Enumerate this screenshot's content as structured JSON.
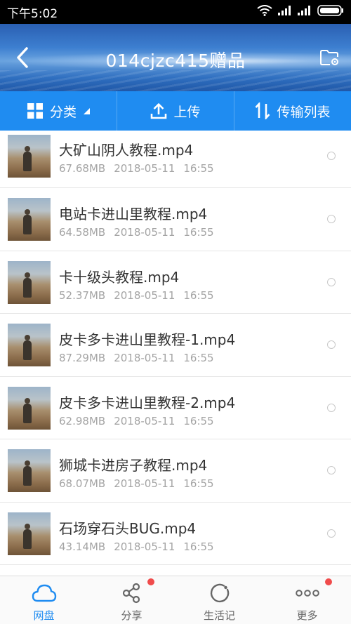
{
  "status_bar": {
    "time": "下午5:02"
  },
  "header": {
    "title": "014cjzc415赠品"
  },
  "toolbar": {
    "category_label": "分类",
    "upload_label": "上传",
    "transfer_label": "传输列表"
  },
  "files": [
    {
      "name": "大矿山阴人教程.mp4",
      "size": "67.68MB",
      "date": "2018-05-11",
      "time": "16:55"
    },
    {
      "name": "电站卡进山里教程.mp4",
      "size": "64.58MB",
      "date": "2018-05-11",
      "time": "16:55"
    },
    {
      "name": "卡十级头教程.mp4",
      "size": "52.37MB",
      "date": "2018-05-11",
      "time": "16:55"
    },
    {
      "name": "皮卡多卡进山里教程-1.mp4",
      "size": "87.29MB",
      "date": "2018-05-11",
      "time": "16:55"
    },
    {
      "name": "皮卡多卡进山里教程-2.mp4",
      "size": "62.98MB",
      "date": "2018-05-11",
      "time": "16:55"
    },
    {
      "name": "狮城卡进房子教程.mp4",
      "size": "68.07MB",
      "date": "2018-05-11",
      "time": "16:55"
    },
    {
      "name": "石场穿石头BUG.mp4",
      "size": "43.14MB",
      "date": "2018-05-11",
      "time": "16:55"
    }
  ],
  "bottom_nav": [
    {
      "label": "网盘",
      "icon": "cloud-icon",
      "active": true,
      "badge": false
    },
    {
      "label": "分享",
      "icon": "share-icon",
      "active": false,
      "badge": true
    },
    {
      "label": "生活记",
      "icon": "life-record-icon",
      "active": false,
      "badge": false
    },
    {
      "label": "更多",
      "icon": "more-icon",
      "active": false,
      "badge": true
    }
  ],
  "colors": {
    "accent": "#1f8cf1",
    "badge": "#f04b4b",
    "meta_text": "#a4a4a4"
  }
}
